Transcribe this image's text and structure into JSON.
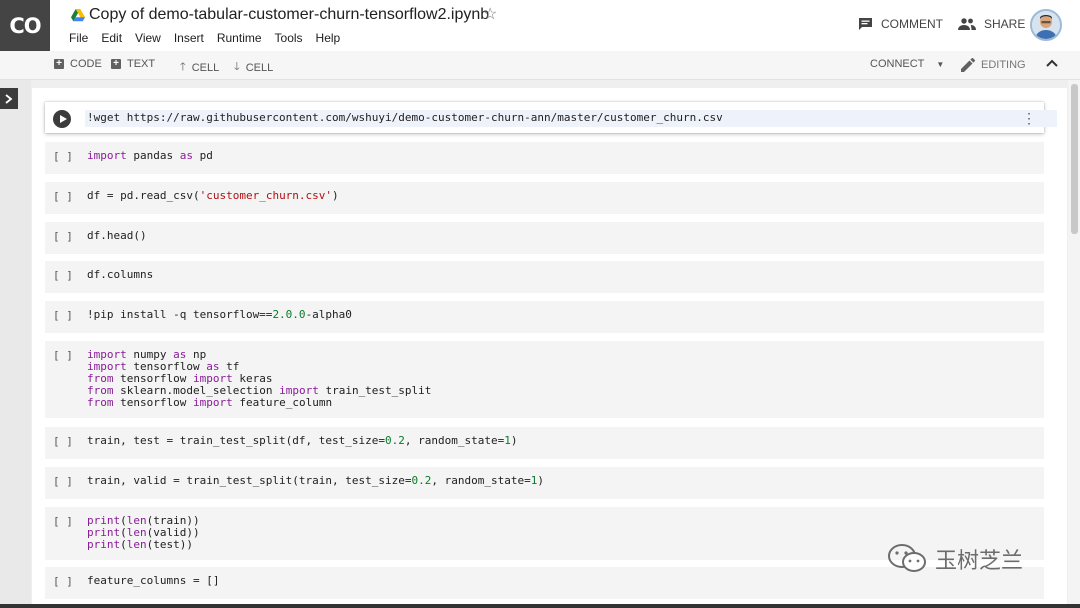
{
  "app": {
    "logo_text": "CO",
    "title": "Copy of demo-tabular-customer-churn-tensorflow2.ipynb",
    "menu": [
      "File",
      "Edit",
      "View",
      "Insert",
      "Runtime",
      "Tools",
      "Help"
    ],
    "comment_label": "COMMENT",
    "share_label": "SHARE"
  },
  "toolbar": {
    "code_label": "CODE",
    "text_label": "TEXT",
    "cell_up_label": "CELL",
    "cell_down_label": "CELL",
    "connect_label": "CONNECT",
    "editing_label": "EDITING"
  },
  "cells": [
    {
      "run": "",
      "lines": [
        [
          {
            "t": "!wget https://raw.githubusercontent.com/wshuyi/demo-customer-churn-ann/master/customer_churn.csv"
          }
        ]
      ]
    },
    {
      "run": "[ ]",
      "lines": [
        [
          {
            "t": "import",
            "c": "kw"
          },
          {
            "t": " pandas "
          },
          {
            "t": "as",
            "c": "kw"
          },
          {
            "t": " pd"
          }
        ]
      ]
    },
    {
      "run": "[ ]",
      "lines": [
        [
          {
            "t": "df = pd.read_csv("
          },
          {
            "t": "'customer_churn.csv'",
            "c": "str"
          },
          {
            "t": ")"
          }
        ]
      ]
    },
    {
      "run": "[ ]",
      "lines": [
        [
          {
            "t": "df.head()"
          }
        ]
      ]
    },
    {
      "run": "[ ]",
      "lines": [
        [
          {
            "t": "df.columns"
          }
        ]
      ]
    },
    {
      "run": "[ ]",
      "lines": [
        [
          {
            "t": "!pip install -q tensorflow=="
          },
          {
            "t": "2.0.0",
            "c": "num"
          },
          {
            "t": "-alpha0"
          }
        ]
      ]
    },
    {
      "run": "[ ]",
      "lines": [
        [
          {
            "t": "import",
            "c": "kw"
          },
          {
            "t": " numpy "
          },
          {
            "t": "as",
            "c": "kw"
          },
          {
            "t": " np"
          }
        ],
        [
          {
            "t": "import",
            "c": "kw"
          },
          {
            "t": " tensorflow "
          },
          {
            "t": "as",
            "c": "kw"
          },
          {
            "t": " tf"
          }
        ],
        [
          {
            "t": "from",
            "c": "kw"
          },
          {
            "t": " tensorflow "
          },
          {
            "t": "import",
            "c": "kw"
          },
          {
            "t": " keras"
          }
        ],
        [
          {
            "t": "from",
            "c": "kw"
          },
          {
            "t": " sklearn.model_selection "
          },
          {
            "t": "import",
            "c": "kw"
          },
          {
            "t": " train_test_split"
          }
        ],
        [
          {
            "t": "from",
            "c": "kw"
          },
          {
            "t": " tensorflow "
          },
          {
            "t": "import",
            "c": "kw"
          },
          {
            "t": " feature_column"
          }
        ]
      ]
    },
    {
      "run": "[ ]",
      "lines": [
        [
          {
            "t": "train, test = train_test_split(df, test_size="
          },
          {
            "t": "0.2",
            "c": "num"
          },
          {
            "t": ", random_state="
          },
          {
            "t": "1",
            "c": "num"
          },
          {
            "t": ")"
          }
        ]
      ]
    },
    {
      "run": "[ ]",
      "lines": [
        [
          {
            "t": "train, valid = train_test_split(train, test_size="
          },
          {
            "t": "0.2",
            "c": "num"
          },
          {
            "t": ", random_state="
          },
          {
            "t": "1",
            "c": "num"
          },
          {
            "t": ")"
          }
        ]
      ]
    },
    {
      "run": "[ ]",
      "lines": [
        [
          {
            "t": "print",
            "c": "kw"
          },
          {
            "t": "("
          },
          {
            "t": "len",
            "c": "kw"
          },
          {
            "t": "(train))"
          }
        ],
        [
          {
            "t": "print",
            "c": "kw"
          },
          {
            "t": "("
          },
          {
            "t": "len",
            "c": "kw"
          },
          {
            "t": "(valid))"
          }
        ],
        [
          {
            "t": "print",
            "c": "kw"
          },
          {
            "t": "("
          },
          {
            "t": "len",
            "c": "kw"
          },
          {
            "t": "(test))"
          }
        ]
      ]
    },
    {
      "run": "[ ]",
      "lines": [
        [
          {
            "t": "feature_columns = []"
          }
        ]
      ]
    }
  ],
  "watermark": "玉树芝兰",
  "colors": {
    "keyword": "#8a1c9a",
    "string": "#b01010",
    "number": "#0b7a2a",
    "logo_bg": "#444444"
  }
}
